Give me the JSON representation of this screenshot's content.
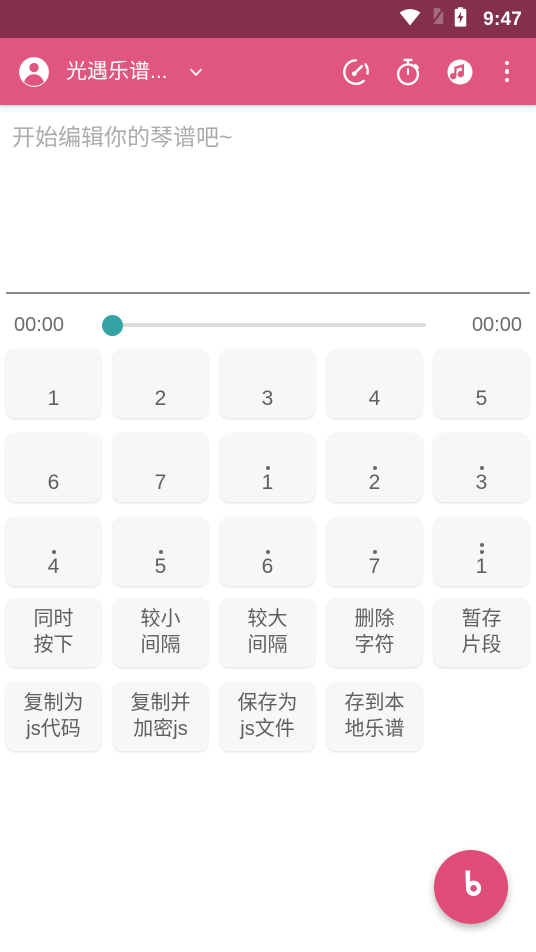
{
  "status_bar": {
    "time": "9:47",
    "icons": [
      "wifi-icon",
      "sim-card-off-icon",
      "battery-charging-icon"
    ],
    "background": "#84304d"
  },
  "app_bar": {
    "background": "#e0567f",
    "account_icon": "account-circle-icon",
    "title": "光遇乐谱...",
    "dropdown_icon": "chevron-down-icon",
    "actions": [
      {
        "name": "speed-icon",
        "label": "速度"
      },
      {
        "name": "timer-icon",
        "label": "计时"
      },
      {
        "name": "music-note-icon",
        "label": "音符"
      }
    ],
    "overflow_icon": "more-vert-icon"
  },
  "editor": {
    "placeholder": "开始编辑你的琴谱吧~",
    "value": ""
  },
  "player": {
    "current_time": "00:00",
    "total_time": "00:00",
    "progress_percent": 0,
    "thumb_color": "#34a3a4",
    "track_color": "#dcdcdc"
  },
  "pads": [
    [
      {
        "num": "1",
        "dots": 0
      },
      {
        "num": "2",
        "dots": 0
      },
      {
        "num": "3",
        "dots": 0
      },
      {
        "num": "4",
        "dots": 0
      },
      {
        "num": "5",
        "dots": 0
      }
    ],
    [
      {
        "num": "6",
        "dots": 0
      },
      {
        "num": "7",
        "dots": 0
      },
      {
        "num": "1",
        "dots": 1
      },
      {
        "num": "2",
        "dots": 1
      },
      {
        "num": "3",
        "dots": 1
      }
    ],
    [
      {
        "num": "4",
        "dots": 1
      },
      {
        "num": "5",
        "dots": 1
      },
      {
        "num": "6",
        "dots": 1
      },
      {
        "num": "7",
        "dots": 1
      },
      {
        "num": "1",
        "dots": 2
      }
    ]
  ],
  "actions": [
    [
      {
        "line1": "同时",
        "line2": "按下"
      },
      {
        "line1": "较小",
        "line2": "间隔"
      },
      {
        "line1": "较大",
        "line2": "间隔"
      },
      {
        "line1": "删除",
        "line2": "字符"
      },
      {
        "line1": "暂存",
        "line2": "片段"
      }
    ],
    [
      {
        "line1": "复制为",
        "line2": "js代码"
      },
      {
        "line1": "复制并",
        "line2": "加密js"
      },
      {
        "line1": "保存为",
        "line2": "js文件"
      },
      {
        "line1": "存到本",
        "line2": "地乐谱"
      }
    ]
  ],
  "fab": {
    "icon": "beats-logo-icon",
    "background": "#df4c78"
  }
}
